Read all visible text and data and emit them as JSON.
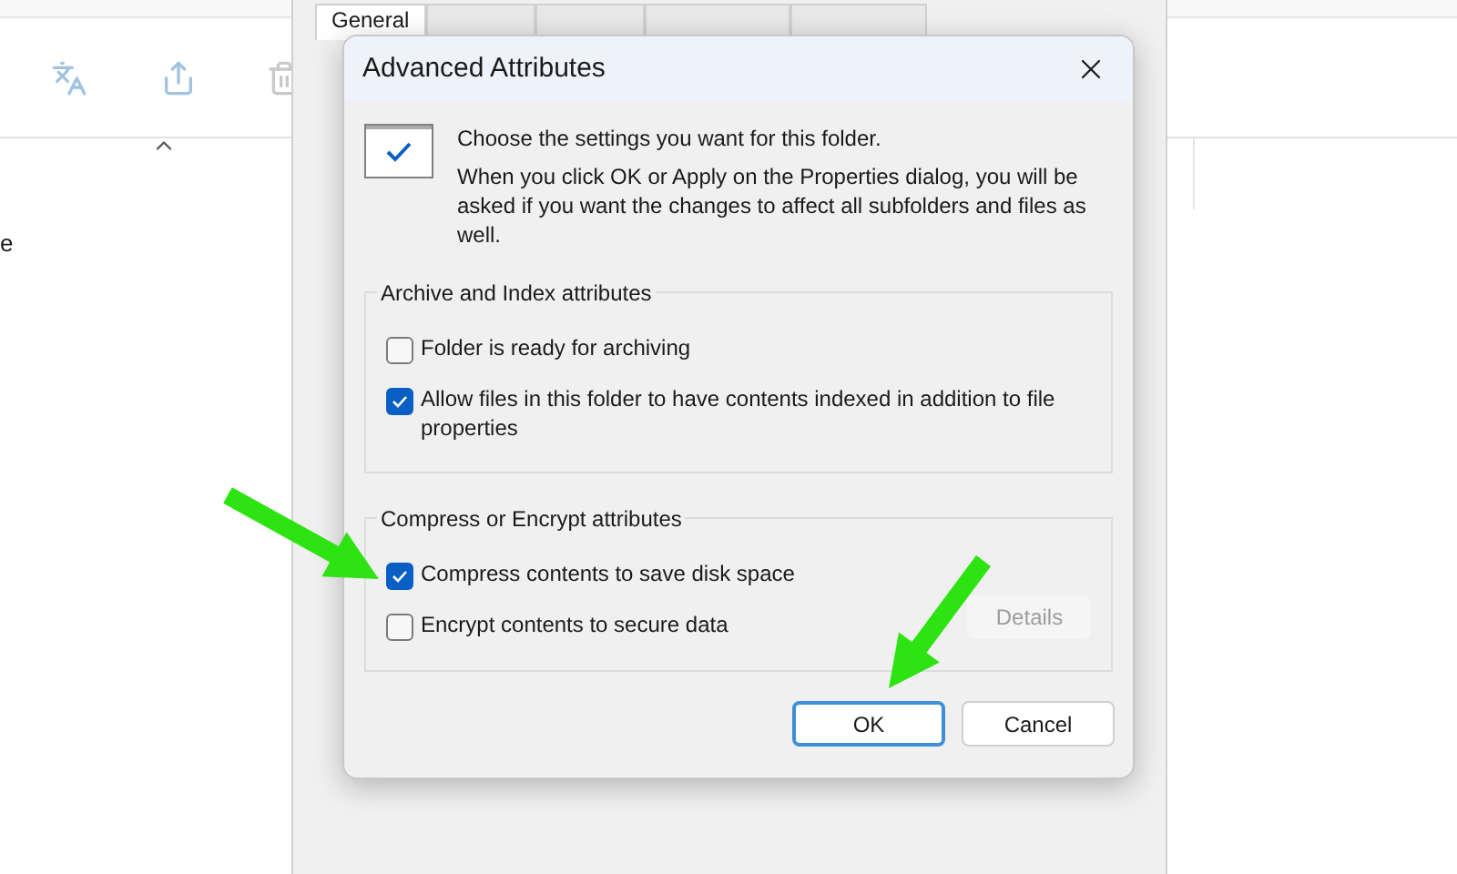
{
  "background": {
    "partial_text": "e"
  },
  "properties_window": {
    "tabs": [
      {
        "label": "General",
        "selected": true
      }
    ]
  },
  "dialog": {
    "title": "Advanced Attributes",
    "intro": "Choose the settings you want for this folder.",
    "description": "When you click OK or Apply on the Properties dialog, you will be asked if you want the changes to affect all subfolders and files as well.",
    "groups": [
      {
        "title": "Archive and Index attributes",
        "options": [
          {
            "label": "Folder is ready for archiving",
            "checked": false
          },
          {
            "label": "Allow files in this folder to have contents indexed in addition to file properties",
            "checked": true
          }
        ]
      },
      {
        "title": "Compress or Encrypt attributes",
        "options": [
          {
            "label": "Compress contents to save disk space",
            "checked": true
          },
          {
            "label": "Encrypt contents to secure data",
            "checked": false
          }
        ],
        "button": {
          "label": "Details",
          "disabled": true
        }
      }
    ],
    "buttons": [
      {
        "label": "OK",
        "default": true
      },
      {
        "label": "Cancel",
        "default": false
      }
    ]
  }
}
